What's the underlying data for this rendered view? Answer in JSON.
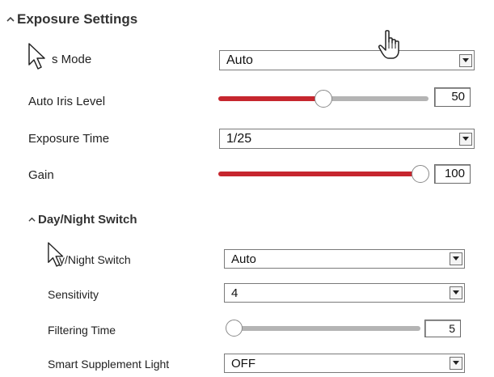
{
  "exposure": {
    "title": "Exposure Settings",
    "iris_mode": {
      "label": "Iris Mode",
      "visible_label": "s Mode",
      "value": "Auto"
    },
    "auto_iris_level": {
      "label": "Auto Iris Level",
      "value": "50",
      "level_fraction": 0.5
    },
    "exposure_time": {
      "label": "Exposure Time",
      "value": "1/25"
    },
    "gain": {
      "label": "Gain",
      "value": "100",
      "level_fraction": 1.0
    }
  },
  "day_night": {
    "title": "Day/Night Switch",
    "switch": {
      "label": "Day/Night Switch",
      "visible_label": "y/Night Switch",
      "value": "Auto"
    },
    "sensitivity": {
      "label": "Sensitivity",
      "value": "4"
    },
    "filtering_time": {
      "label": "Filtering Time",
      "value": "5",
      "level_fraction": 0.0
    },
    "smart_supplement_light": {
      "label": "Smart Supplement Light",
      "value": "OFF"
    }
  },
  "icons": {
    "collapse": "caret-up-icon",
    "dropdown": "dropdown-arrow-icon",
    "pointer": "hand-pointer-cursor",
    "arrow": "arrow-cursor"
  },
  "colors": {
    "slider_active": "#c6262e",
    "slider_inactive": "#b4b4b4"
  }
}
